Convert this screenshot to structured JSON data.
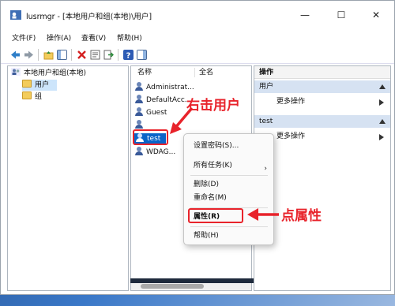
{
  "window": {
    "title": "lusrmgr - [本地用户和组(本地)\\用户]",
    "minimize_glyph": "—",
    "maximize_glyph": "☐",
    "close_glyph": "✕"
  },
  "menu": [
    "文件(F)",
    "操作(A)",
    "查看(V)",
    "帮助(H)"
  ],
  "tree": {
    "root": "本地用户和组(本地)",
    "items": [
      "用户",
      "组"
    ]
  },
  "list": {
    "columns": [
      "名称",
      "全名"
    ],
    "users": [
      "Administrat...",
      "DefaultAcc...",
      "Guest",
      "",
      "test",
      "WDAG..."
    ]
  },
  "actions": {
    "title": "操作",
    "groups": [
      {
        "label": "用户",
        "item": "更多操作"
      },
      {
        "label": "test",
        "item": "更多操作"
      }
    ]
  },
  "context_menu": {
    "items": [
      "设置密码(S)...",
      "所有任务(K)",
      "删除(D)",
      "重命名(M)",
      "属性(R)",
      "帮助(H)"
    ],
    "submenu_glyph": "›"
  },
  "annotations": {
    "right_click_label": "右击用户",
    "properties_label": "点属性",
    "color": "#e8232b"
  },
  "colors": {
    "selection": "#0a64c8",
    "action_group_bg": "#d6e2f2",
    "annotation": "#e8232b"
  }
}
